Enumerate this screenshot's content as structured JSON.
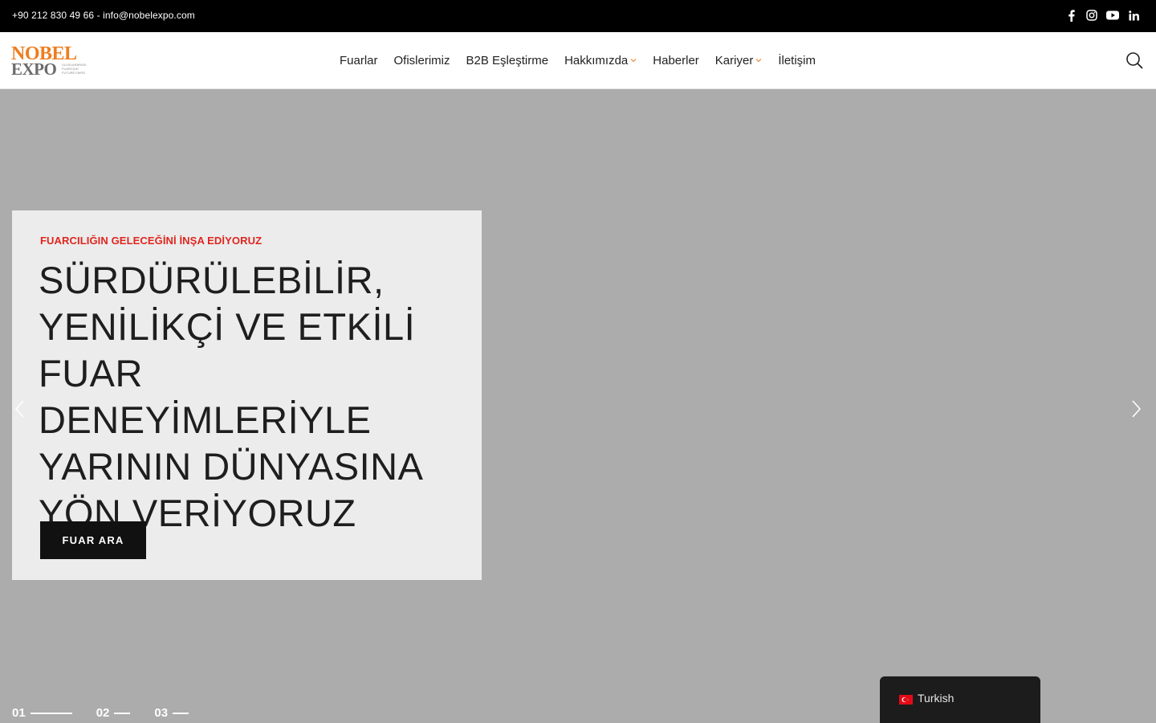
{
  "topbar": {
    "contact": "+90 212 830 49 66 - info@nobelexpo.com",
    "social": [
      "facebook-icon",
      "instagram-icon",
      "youtube-icon",
      "linkedin-icon"
    ]
  },
  "logo": {
    "line1": "NOBEL",
    "line2": "EXPO",
    "tag1": "ULUSLARARASI",
    "tag2": "FUARCILIK",
    "tag3": "FUTURE FAIRS"
  },
  "nav": {
    "items": [
      {
        "label": "Fuarlar",
        "dropdown": false
      },
      {
        "label": "Ofislerimiz",
        "dropdown": false
      },
      {
        "label": "B2B Eşleştirme",
        "dropdown": false
      },
      {
        "label": "Hakkımızda",
        "dropdown": true
      },
      {
        "label": "Haberler",
        "dropdown": false
      },
      {
        "label": "Kariyer",
        "dropdown": true
      },
      {
        "label": "İletişim",
        "dropdown": false
      }
    ]
  },
  "hero": {
    "eyebrow": "FUARCILIĞIN GELECEĞİNİ İNŞA EDİYORUZ",
    "headline": [
      "SÜRDÜRÜLEBİLİR,",
      "YENİLİKÇİ VE ETKİLİ",
      "FUAR DENEYİMLERİYLE",
      "YARININ DÜNYASINA",
      "YÖN VERİYORUZ"
    ],
    "cta": "FUAR ARA"
  },
  "pager": [
    {
      "label": "01",
      "active": true
    },
    {
      "label": "02",
      "active": false
    },
    {
      "label": "03",
      "active": false
    }
  ],
  "language": {
    "label": "Turkish"
  },
  "colors": {
    "accent": "#e0251f",
    "logo_orange": "#ee7d1f",
    "logo_gray": "#6b6b6b",
    "hero_bg": "#acacac",
    "card_bg": "#ececec",
    "button_bg": "#111111"
  }
}
